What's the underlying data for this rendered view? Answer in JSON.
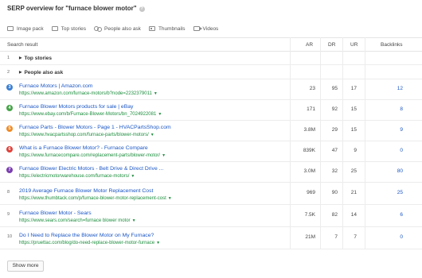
{
  "title": "SERP overview for \"furnace blower motor\"",
  "features": [
    "Image pack",
    "Top stories",
    "People also ask",
    "Thumbnails",
    "Videos"
  ],
  "columns": {
    "result": "Search result",
    "ar": "AR",
    "dr": "DR",
    "ur": "UR",
    "backlinks": "Backlinks"
  },
  "rows": [
    {
      "num": "1",
      "label": "Top stories"
    },
    {
      "num": "2",
      "label": "People also ask"
    },
    {
      "num": "3",
      "badge_color": "#3b7fd4",
      "title": "Furnace Motors | Amazon.com",
      "url": "https://www.amazon.com/furnace-motors/b?node=2232379011",
      "ar": "23",
      "dr": "95",
      "ur": "17",
      "backlinks": "12"
    },
    {
      "num": "4",
      "badge_color": "#45a447",
      "title": "Furnace Blower Motors products for sale | eBay",
      "url": "https://www.ebay.com/b/Furnace-Blower-Motors/bn_7024922081",
      "ar": "171",
      "dr": "92",
      "ur": "15",
      "backlinks": "8"
    },
    {
      "num": "5",
      "badge_color": "#f08a24",
      "title": "Furnace Parts - Blower Motors - Page 1 - HVACPartsShop.com",
      "url": "https://www.hvacpartsshop.com/furnace-parts/blower-motors/",
      "ar": "3.8M",
      "dr": "29",
      "ur": "15",
      "backlinks": "9"
    },
    {
      "num": "6",
      "badge_color": "#e0403a",
      "title": "What is a Furnace Blower Motor? - Furnace Compare",
      "url": "https://www.furnacecompare.com/replacement-parts/blower-motor/",
      "ar": "839K",
      "dr": "47",
      "ur": "9",
      "backlinks": "0"
    },
    {
      "num": "7",
      "badge_color": "#7b3fb0",
      "title": "Furnace Blower Electric Motors - Belt Drive & Direct Drive ...",
      "url": "https://electricmotorwarehouse.com/furnace-motors/",
      "ar": "3.0M",
      "dr": "32",
      "ur": "25",
      "backlinks": "80"
    },
    {
      "num": "8",
      "title": "2019 Average Furnace Blower Motor Replacement Cost",
      "url": "https://www.thumbtack.com/p/furnace-blower-motor-replacement-cost",
      "ar": "969",
      "dr": "90",
      "ur": "21",
      "backlinks": "25"
    },
    {
      "num": "9",
      "title": "Furnace Blower Motor - Sears",
      "url": "https://www.sears.com/search=furnace blower motor",
      "ar": "7.5K",
      "dr": "82",
      "ur": "14",
      "backlinks": "6"
    },
    {
      "num": "10",
      "title": "Do I Need to Replace the Blower Motor on My Furnace?",
      "url": "https://pruettac.com/blog/do-need-replace-blower-motor-furnace",
      "ar": "21M",
      "dr": "7",
      "ur": "7",
      "backlinks": "0"
    }
  ],
  "show_more": "Show more",
  "icons": {
    "help": "help-icon",
    "image_pack": "image-icon",
    "top_stories": "news-icon",
    "people_also_ask": "people-icon",
    "thumbnails": "thumbnail-icon",
    "videos": "video-icon",
    "expand": "triangle-right-icon",
    "url_dropdown": "caret-down-icon"
  },
  "colors": {
    "link": "#1a56c5",
    "url": "#1d8e3e"
  }
}
